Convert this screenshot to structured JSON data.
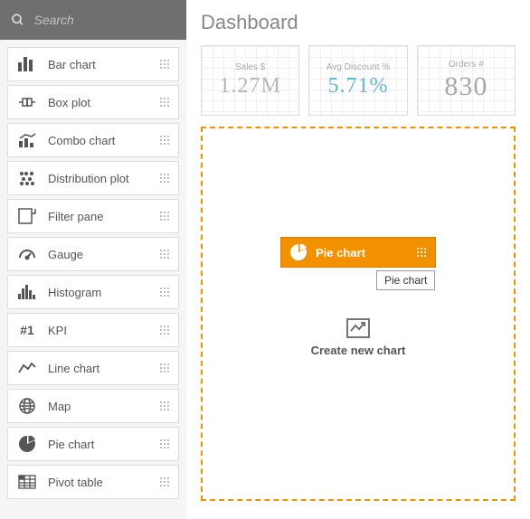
{
  "search": {
    "placeholder": "Search"
  },
  "chart_types": [
    {
      "id": "bar",
      "label": "Bar chart"
    },
    {
      "id": "box",
      "label": "Box plot"
    },
    {
      "id": "combo",
      "label": "Combo chart"
    },
    {
      "id": "dist",
      "label": "Distribution plot"
    },
    {
      "id": "filter",
      "label": "Filter pane"
    },
    {
      "id": "gauge",
      "label": "Gauge"
    },
    {
      "id": "hist",
      "label": "Histogram"
    },
    {
      "id": "kpi",
      "label": "KPI"
    },
    {
      "id": "line",
      "label": "Line chart"
    },
    {
      "id": "map",
      "label": "Map"
    },
    {
      "id": "pie",
      "label": "Pie chart"
    },
    {
      "id": "pivot",
      "label": "Pivot table"
    }
  ],
  "page_title": "Dashboard",
  "kpis": [
    {
      "label": "Sales $",
      "value": "1.27M"
    },
    {
      "label": "Avg Discount %",
      "value": "5.71%"
    },
    {
      "label": "Orders #",
      "value": "830"
    }
  ],
  "drag": {
    "label": "Pie chart",
    "tooltip": "Pie chart"
  },
  "drop": {
    "text": "Create new chart"
  }
}
